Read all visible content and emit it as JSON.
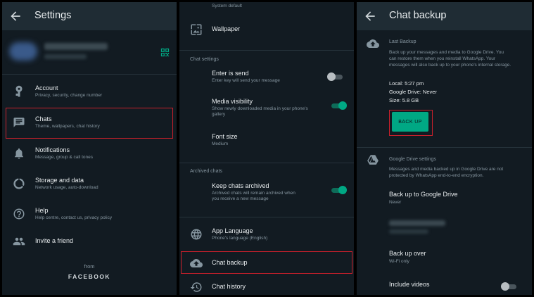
{
  "panel1": {
    "title": "Settings",
    "items": [
      {
        "key": "account",
        "label": "Account",
        "sub": "Privacy, security, change number"
      },
      {
        "key": "chats",
        "label": "Chats",
        "sub": "Theme, wallpapers, chat history"
      },
      {
        "key": "notifications",
        "label": "Notifications",
        "sub": "Message, group & call tones"
      },
      {
        "key": "storage",
        "label": "Storage and data",
        "sub": "Network usage, auto-download"
      },
      {
        "key": "help",
        "label": "Help",
        "sub": "Help centre, contact us, privacy policy"
      },
      {
        "key": "invite",
        "label": "Invite a friend",
        "sub": ""
      }
    ],
    "footer_from": "from",
    "footer_brand": "FACEBOOK"
  },
  "panel2": {
    "top_item_sub": "System default",
    "wallpaper": "Wallpaper",
    "section_chat": "Chat settings",
    "enter_send": {
      "label": "Enter is send",
      "sub": "Enter key will send your message"
    },
    "media_visibility": {
      "label": "Media visibility",
      "sub1": "Show newly downloaded media in your phone's",
      "sub2": "gallery"
    },
    "font_size": {
      "label": "Font size",
      "sub": "Medium"
    },
    "section_archived": "Archived chats",
    "keep_archived": {
      "label": "Keep chats archived",
      "sub1": "Archived chats will remain archived when",
      "sub2": "you receive a new message"
    },
    "app_language": {
      "label": "App Language",
      "sub": "Phone's language (English)"
    },
    "chat_backup": "Chat backup",
    "chat_history": "Chat history"
  },
  "panel3": {
    "title": "Chat backup",
    "last_backup": "Last Backup",
    "desc1": "Back up your messages and media to Google Drive. You",
    "desc2": "can restore them when you reinstall WhatsApp. Your",
    "desc3": "messages will also back up to your phone's internal storage.",
    "local": "Local: 5:27 pm",
    "gdrive": "Google Drive: Never",
    "size": "Size: 5.8 GB",
    "backup_btn": "BACK UP",
    "gd_settings": "Google Drive settings",
    "gd_desc1": "Messages and media backed up in Google Drive are not",
    "gd_desc2": "protected by WhatsApp end-to-end encryption.",
    "backup_to_gd": "Back up to Google Drive",
    "backup_to_gd_sub": "Never",
    "backup_over": "Back up over",
    "backup_over_sub": "Wi-Fi only",
    "include_videos": "Include videos"
  },
  "colors": {
    "accent": "#00a884",
    "highlight": "#c8202b",
    "bg": "#121b22",
    "appbar": "#1f2c34"
  }
}
